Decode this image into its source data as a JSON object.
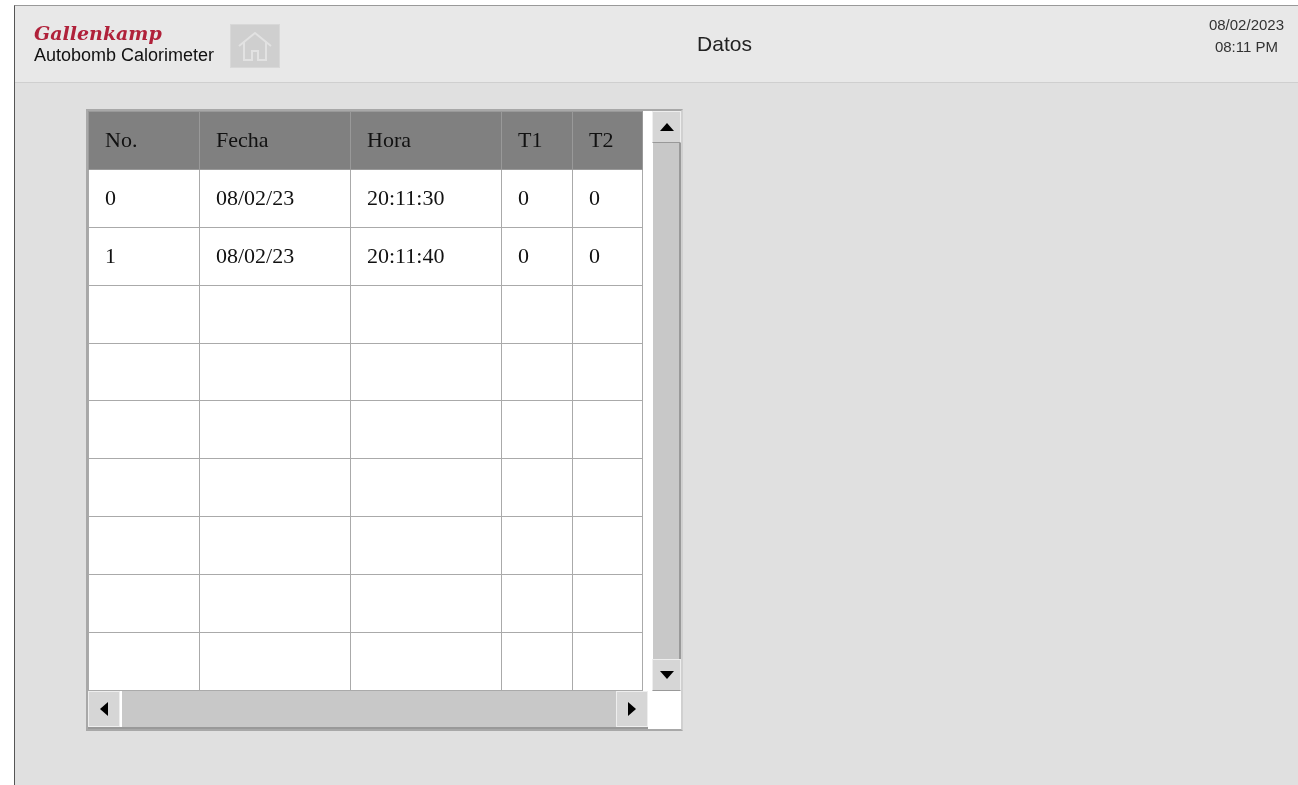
{
  "header": {
    "brand": "Gallenkamp",
    "product": "Autobomb Calorimeter",
    "title": "Datos",
    "date": "08/02/2023",
    "time": "08:11 PM"
  },
  "table": {
    "columns": [
      "No.",
      "Fecha",
      "Hora",
      "T1",
      "T2"
    ],
    "rows": [
      [
        "0",
        "08/02/23",
        "20:11:30",
        "0",
        "0"
      ],
      [
        "1",
        "08/02/23",
        "20:11:40",
        "0",
        "0"
      ]
    ]
  }
}
